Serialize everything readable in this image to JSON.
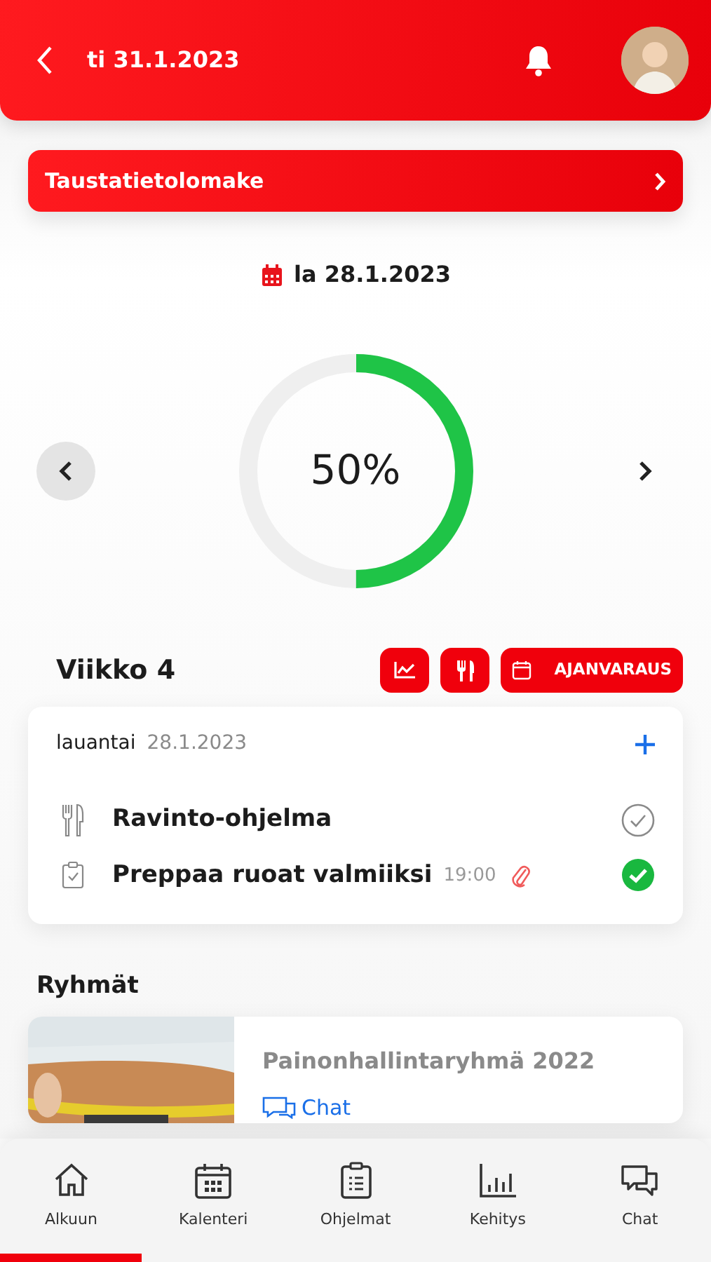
{
  "header": {
    "date": "ti 31.1.2023"
  },
  "form_button": {
    "label": "Taustatietolomake"
  },
  "day": {
    "date": "la 28.1.2023",
    "progress_text": "50%",
    "level": 0.5
  },
  "week": {
    "title": "Viikko 4",
    "booking_label": "AJANVARAUS"
  },
  "day_card": {
    "weekday": "lauantai",
    "date": "28.1.2023",
    "tasks": [
      {
        "kind": "nutrition",
        "title": "Ravinto-ohjelma",
        "done": false
      },
      {
        "kind": "task",
        "title": "Preppaa ruoat valmiiksi",
        "time": "19:00",
        "attachment": true,
        "done": true
      }
    ]
  },
  "groups": {
    "title": "Ryhmät",
    "items": [
      {
        "name": "Painonhallintaryhmä 2022",
        "chat_label": "Chat"
      }
    ]
  },
  "nav": [
    {
      "kind": "home",
      "label": "Alkuun",
      "selected": true
    },
    {
      "kind": "calendar",
      "label": "Kalenteri",
      "selected": false
    },
    {
      "kind": "programs",
      "label": "Ohjelmat",
      "selected": false
    },
    {
      "kind": "progress",
      "label": "Kehitys",
      "selected": false
    },
    {
      "kind": "chat",
      "label": "Chat",
      "selected": false
    }
  ]
}
